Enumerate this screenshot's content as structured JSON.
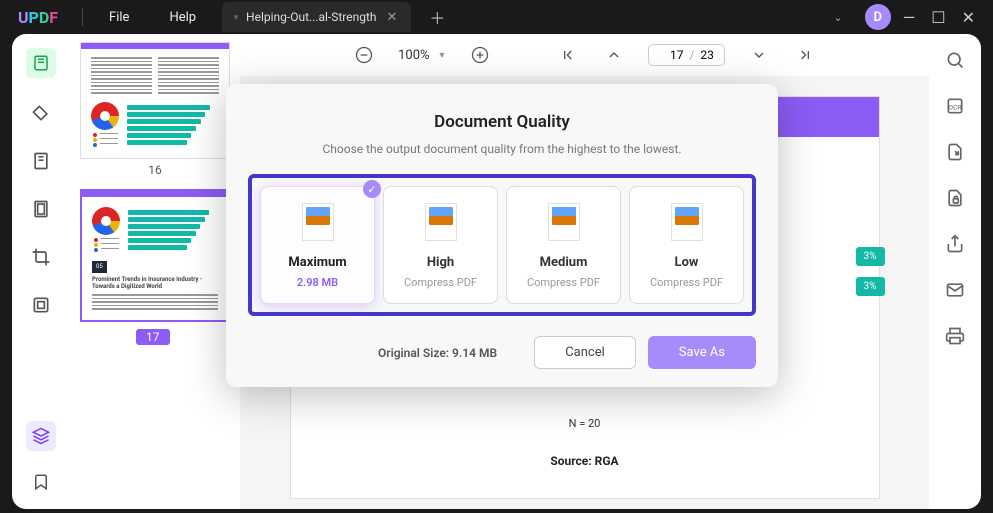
{
  "titlebar": {
    "menu_file": "File",
    "menu_help": "Help",
    "tab_title": "Helping-Out...al-Strength",
    "avatar_initial": "D"
  },
  "toolbar": {
    "zoom": "100%",
    "page_current": "17",
    "page_total": "23"
  },
  "thumbnails": {
    "page16_label": "16",
    "page17_label": "17",
    "page17_section_num": "05",
    "page17_section_title": "Prominent Trends in Insurance Industry - Towards a Digitized World"
  },
  "document": {
    "n_text": "N = 20",
    "source_text": "Source: RGA",
    "badge1": "3%",
    "badge2": "3%"
  },
  "modal": {
    "title": "Document Quality",
    "subtitle": "Choose the output document quality from the highest to the lowest.",
    "options": [
      {
        "name": "Maximum",
        "sub": "2.98 MB"
      },
      {
        "name": "High",
        "sub": "Compress PDF"
      },
      {
        "name": "Medium",
        "sub": "Compress PDF"
      },
      {
        "name": "Low",
        "sub": "Compress PDF"
      }
    ],
    "original_size": "Original Size: 9.14 MB",
    "cancel": "Cancel",
    "save_as": "Save As"
  }
}
